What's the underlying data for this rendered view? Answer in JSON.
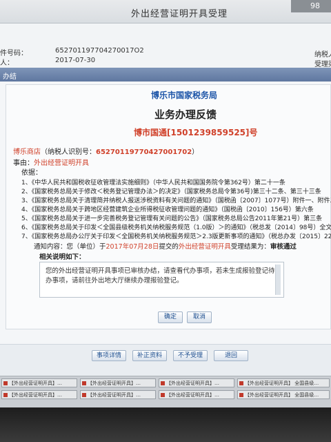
{
  "window": {
    "title": "外出经营证明开具受理",
    "corner_value": "98"
  },
  "info": {
    "tin_label": "件号码：",
    "tin_value": "652701197704270017O2",
    "date_label": "人：",
    "date_value": "2017-07-30",
    "right_label_1": "纳税人",
    "right_label_2": "受理渠"
  },
  "panel_header": "办结",
  "doc": {
    "agency": "博乐市国家税务局",
    "title": "业务办理反馈",
    "doc_no": "博市国通[1501239859525]号",
    "shop_name": "博乐商店",
    "tin_prefix": "（纳税人识别号：",
    "tin": "65270119770427001702",
    "tin_suffix": "）",
    "matter_label": "事由：",
    "matter": "外出经营证明开具",
    "basis_label": "依据：",
    "laws": [
      "1、《中华人民共和国税收征收管理法实施细则》（中华人民共和国国务院令第362号）第二十一条",
      "2、《国家税务总局关于修改＜税务登记管理办法＞的决定》（国家税务总局令第36号)第三十二条、第三十三条",
      "3、《国家税务总局关于清理简并纳税人报送涉税资料有关问题的通知》（国税函〔2007〕1077号）附件一、附件二、附件",
      "4、《国家税务总局关于跨地区经营建筑企业所得税征收管理问题的通知》（国税函〔2010〕156号）第六条",
      "5、《国家税务总局关于进一步完善税务登记管理有关问题的公告》（国家税务总局公告2011年第21号）第三条",
      "6、《国家税务总局关于印发＜全国县级税务机关纳税服务规范（1.0版）＞的通知》（税总发〔2014〕98号）全文",
      "7、《国家税务总局办公厅关于印发＜全国税务机关纳税服务规范＞2.3版更新事项的通知》（税总办发〔2015〕224号）"
    ],
    "notice_prefix": "通知内容：您（单位）于",
    "notice_date": "2017年07月28日",
    "notice_mid": "提交的",
    "notice_matter": "外出经营证明开具",
    "notice_suffix": "受理结果为：",
    "notice_result": "审核通过",
    "desc_label": "相关说明如下：",
    "desc_text": "您的外出经营证明开具事项已审核办结，请查看代办事项，若未生成报验登记待办事项，请前往外出地大厅继续办理报验登记。",
    "ok_label": "确定",
    "cancel_label": "取消"
  },
  "footer_buttons": [
    "事项详情",
    "补正资料",
    "不予受理",
    "退回"
  ],
  "taskbar": [
    "【外出经营证明开具】…",
    "【外出经营证明开具】…",
    "【外出经营证明开具】…",
    "【外出经营证明开具】 全国县级…",
    "【外出经营证明开具】…",
    "【外出经营证明开具】…",
    "【外出经营证明开具】…",
    "【外出经营证明开具】 全国县级…"
  ]
}
